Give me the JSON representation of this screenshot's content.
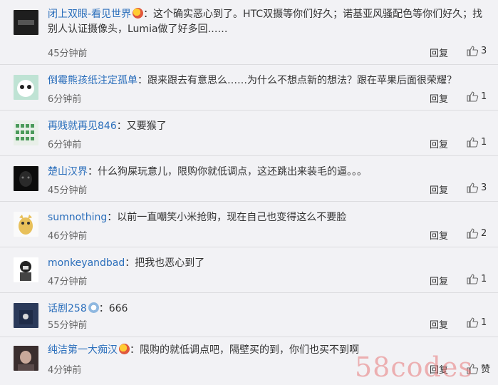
{
  "comments": [
    {
      "user": "闭上双眼-看见世界",
      "badge": "vip",
      "text": "：这个确实恶心到了。HTC双摄等你们好久；诺基亚风骚配色等你们好久；找别人认证摄像头，Lumia做了好多回……",
      "time": "45分钟前",
      "reply": "回复",
      "likes": "3"
    },
    {
      "user": "倒霉熊孩纸注定孤单",
      "badge": "",
      "text": "：跟来跟去有意思么……为什么不想点新的想法？跟在苹果后面很荣耀？",
      "time": "6分钟前",
      "reply": "回复",
      "likes": "1"
    },
    {
      "user": "再贱就再见846",
      "badge": "",
      "text": "：又要猴了",
      "time": "6分钟前",
      "reply": "回复",
      "likes": "1"
    },
    {
      "user": "楚山汉界",
      "badge": "",
      "text": "：什么狗屎玩意儿，限购你就低调点，这还跳出来装毛的逼。。。",
      "time": "45分钟前",
      "reply": "回复",
      "likes": "3"
    },
    {
      "user": "sumnothing",
      "badge": "",
      "text": "：以前一直嘲笑小米抢购，现在自己也变得这么不要脸",
      "time": "46分钟前",
      "reply": "回复",
      "likes": "2"
    },
    {
      "user": "monkeyandbad",
      "badge": "",
      "text": "：把我也恶心到了",
      "time": "47分钟前",
      "reply": "回复",
      "likes": "1"
    },
    {
      "user": "话剧258",
      "badge": "lvl",
      "text": "：666",
      "time": "55分钟前",
      "reply": "回复",
      "likes": "1"
    },
    {
      "user": "纯洁第一大痴汉",
      "badge": "vip",
      "text": "：限购的就低调点吧，隔壁买的到，你们也买不到啊",
      "time": "4分钟前",
      "reply": "回复",
      "likes": "赞"
    }
  ],
  "watermark": "58codes",
  "colors": {
    "username": "#2a6ebb",
    "background": "#f2f2f5"
  }
}
